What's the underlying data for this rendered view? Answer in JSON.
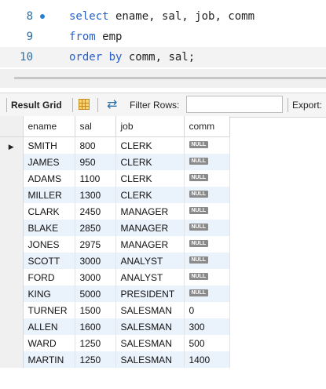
{
  "editor": {
    "lines": [
      {
        "number": "8",
        "tokens": [
          {
            "t": "select",
            "kw": true
          },
          {
            "t": " ename, sal, job, comm",
            "kw": false
          }
        ]
      },
      {
        "number": "9",
        "tokens": [
          {
            "t": "from",
            "kw": true
          },
          {
            "t": " emp",
            "kw": false
          }
        ]
      },
      {
        "number": "10",
        "tokens": [
          {
            "t": "order by",
            "kw": true
          },
          {
            "t": " comm, sal;",
            "kw": false
          }
        ]
      }
    ]
  },
  "toolbar": {
    "result_grid_label": "Result Grid",
    "filter_label": "Filter Rows:",
    "filter_value": "",
    "export_label": "Export:"
  },
  "grid": {
    "columns": [
      "ename",
      "sal",
      "job",
      "comm"
    ],
    "null_label": "NULL",
    "rows": [
      [
        "SMITH",
        "800",
        "CLERK",
        null
      ],
      [
        "JAMES",
        "950",
        "CLERK",
        null
      ],
      [
        "ADAMS",
        "1100",
        "CLERK",
        null
      ],
      [
        "MILLER",
        "1300",
        "CLERK",
        null
      ],
      [
        "CLARK",
        "2450",
        "MANAGER",
        null
      ],
      [
        "BLAKE",
        "2850",
        "MANAGER",
        null
      ],
      [
        "JONES",
        "2975",
        "MANAGER",
        null
      ],
      [
        "SCOTT",
        "3000",
        "ANALYST",
        null
      ],
      [
        "FORD",
        "3000",
        "ANALYST",
        null
      ],
      [
        "KING",
        "5000",
        "PRESIDENT",
        null
      ],
      [
        "TURNER",
        "1500",
        "SALESMAN",
        "0"
      ],
      [
        "ALLEN",
        "1600",
        "SALESMAN",
        "300"
      ],
      [
        "WARD",
        "1250",
        "SALESMAN",
        "500"
      ],
      [
        "MARTIN",
        "1250",
        "SALESMAN",
        "1400"
      ]
    ],
    "current_row_marker": "▶"
  }
}
